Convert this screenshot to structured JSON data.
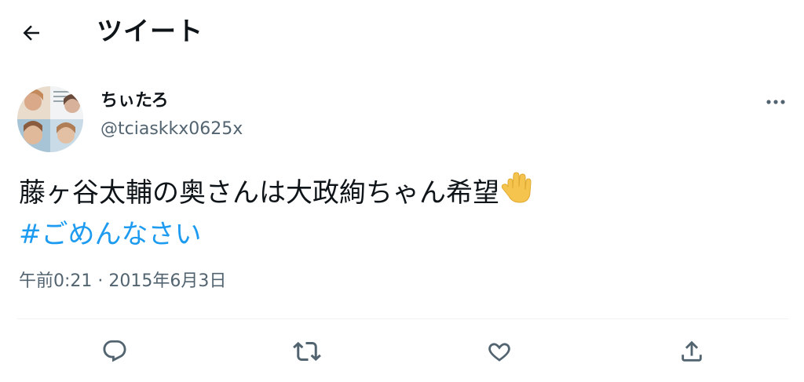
{
  "header": {
    "title": "ツイート",
    "back_icon": "arrow-left-icon"
  },
  "tweet": {
    "author": {
      "display_name": "ちぃたろ",
      "handle": "@tciaskkx0625x"
    },
    "text": "藤ヶ谷太輔の奥さんは大政絢ちゃん希望",
    "emoji": "raised-hand-emoji",
    "hashtag": "#ごめんなさい",
    "timestamp": "午前0:21 · 2015年6月3日"
  },
  "actions": [
    {
      "name": "reply",
      "icon": "reply-icon"
    },
    {
      "name": "retweet",
      "icon": "retweet-icon"
    },
    {
      "name": "like",
      "icon": "heart-icon"
    },
    {
      "name": "share",
      "icon": "share-icon"
    }
  ],
  "colors": {
    "text": "#0f1419",
    "secondary": "#536471",
    "link": "#1d9bf0",
    "divider": "#eff3f4",
    "emoji": "#f4c44e"
  }
}
